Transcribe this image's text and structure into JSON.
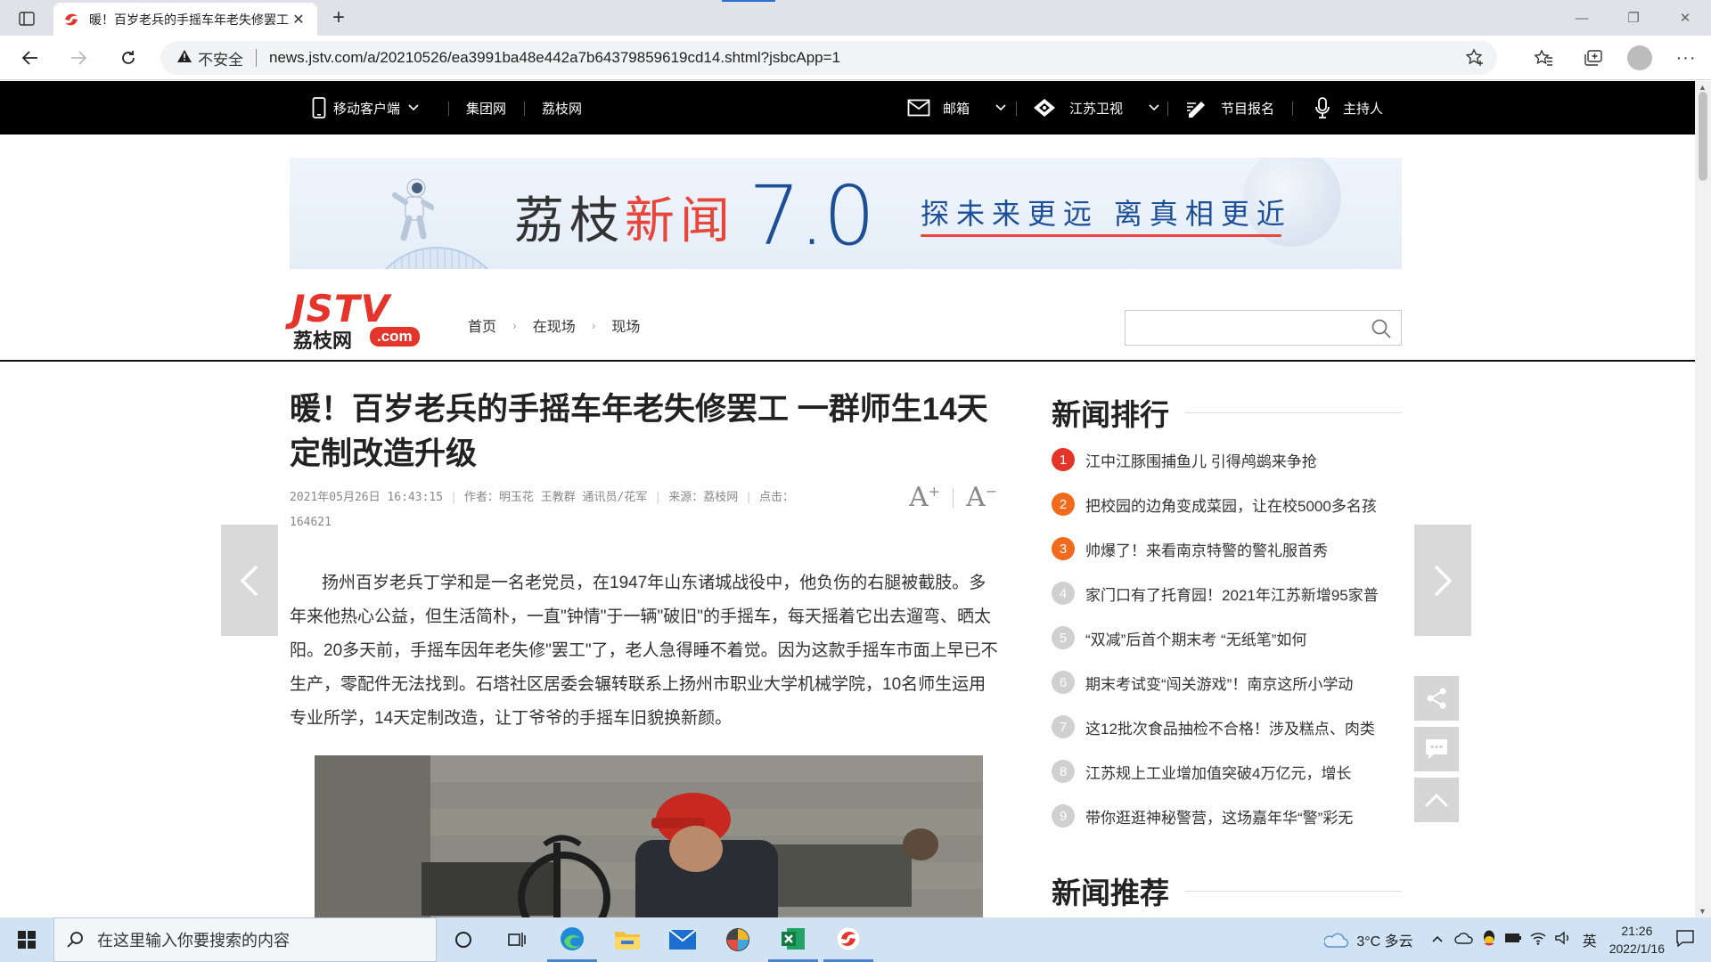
{
  "browser": {
    "tab_title": "暖！百岁老兵的手摇车年老失修罢工 一群师生14天定制改造升级",
    "security_label": "不安全",
    "url": "news.jstv.com/a/20210526/ea3991ba48e442a7b64379859619cd14.shtml?jsbcApp=1"
  },
  "site_nav": {
    "left": [
      "移动客户端",
      "集团网",
      "荔枝网"
    ],
    "right": [
      "邮箱",
      "江苏卫视",
      "节目报名",
      "主持人"
    ]
  },
  "banner": {
    "brand_a": "荔枝",
    "brand_b": "新闻",
    "version": "7.0",
    "slogan": "探未来更远  离真相更近"
  },
  "logo": {
    "main": "JSTV",
    "cn": "荔枝网",
    "com": ".com"
  },
  "breadcrumb": [
    "首页",
    "在现场",
    "现场"
  ],
  "article": {
    "title": "暖！百岁老兵的手摇车年老失修罢工 一群师生14天定制改造升级",
    "date": "2021年05月26日 16:43:15",
    "author": "作者：明玉花 王教群 通讯员/花军",
    "source": "来源：荔枝网",
    "clicks_label": "点击：",
    "clicks": "164621",
    "font_up": "A",
    "font_down": "A",
    "body": "扬州百岁老兵丁学和是一名老党员，在1947年山东诸城战役中，他负伤的右腿被截肢。多年来他热心公益，但生活简朴，一直\"钟情\"于一辆\"破旧\"的手摇车，每天摇着它出去遛弯、晒太阳。20多天前，手摇车因年老失修\"罢工\"了，老人急得睡不着觉。因为这款手摇车市面上早已不生产，零配件无法找到。石塔社区居委会辗转联系上扬州市职业大学机械学院，10名师生运用专业所学，14天定制改造，让丁爷爷的手摇车旧貌换新颜。"
  },
  "sidebar": {
    "ranking_title": "新闻排行",
    "ranking": [
      {
        "n": "1",
        "text": "江中江豚围捕鱼儿 引得鸬鹚来争抢"
      },
      {
        "n": "2",
        "text": "把校园的边角变成菜园，让在校5000多名孩"
      },
      {
        "n": "3",
        "text": "帅爆了！来看南京特警的警礼服首秀"
      },
      {
        "n": "4",
        "text": "家门口有了托育园！2021年江苏新增95家普"
      },
      {
        "n": "5",
        "text": "“双减”后首个期末考 “无纸笔”如何"
      },
      {
        "n": "6",
        "text": "期末考试变“闯关游戏”！南京这所小学动"
      },
      {
        "n": "7",
        "text": "这12批次食品抽检不合格！涉及糕点、肉类"
      },
      {
        "n": "8",
        "text": "江苏规上工业增加值突破4万亿元，增长"
      },
      {
        "n": "9",
        "text": "带你逛逛神秘警营，这场嘉年华“警”彩无"
      }
    ],
    "recommend_title": "新闻推荐"
  },
  "taskbar": {
    "search_placeholder": "在这里输入你要搜索的内容",
    "weather": "3°C 多云",
    "ime": "英",
    "time": "21:26",
    "date": "2022/1/16"
  }
}
